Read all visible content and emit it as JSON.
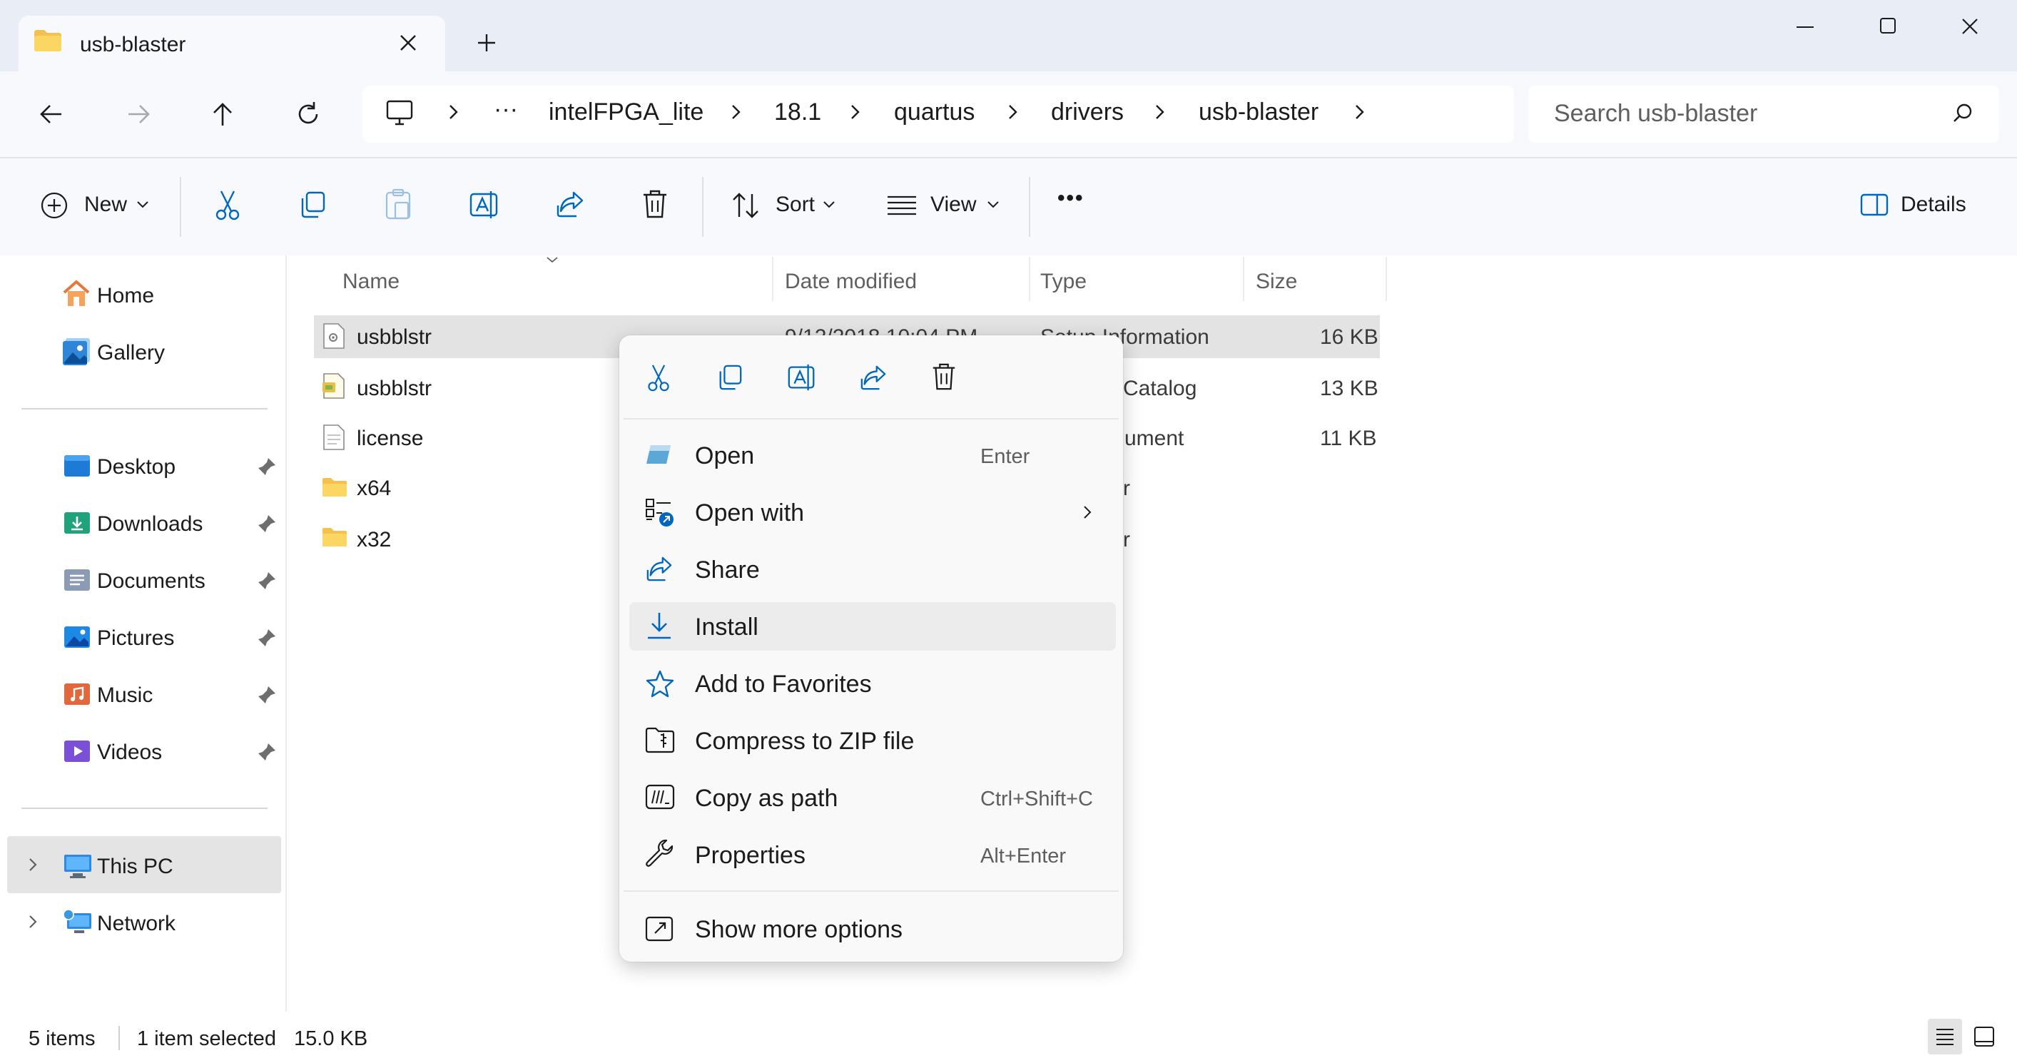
{
  "window": {
    "tab_title": "usb-blaster"
  },
  "breadcrumb": {
    "ellipsis": "···",
    "items": [
      "intelFPGA_lite",
      "18.1",
      "quartus",
      "drivers",
      "usb-blaster"
    ]
  },
  "search": {
    "placeholder": "Search usb-blaster"
  },
  "toolbar": {
    "new_label": "New",
    "sort_label": "Sort",
    "view_label": "View",
    "more_label": "•••",
    "details_label": "Details"
  },
  "sidebar": {
    "items": [
      {
        "label": "Home"
      },
      {
        "label": "Gallery"
      },
      {
        "label": "Desktop"
      },
      {
        "label": "Downloads"
      },
      {
        "label": "Documents"
      },
      {
        "label": "Pictures"
      },
      {
        "label": "Music"
      },
      {
        "label": "Videos"
      },
      {
        "label": "This PC"
      },
      {
        "label": "Network"
      }
    ]
  },
  "file_list": {
    "columns": [
      "Name",
      "Date modified",
      "Type",
      "Size"
    ],
    "rows": [
      {
        "name": "usbblstr",
        "date": "9/12/2018 10:04 PM",
        "type": "Setup Information",
        "size": "16 KB",
        "selected": true
      },
      {
        "name": "usbblstr",
        "date": "",
        "type": "Catalog",
        "size": "13 KB"
      },
      {
        "name": "license",
        "date": "",
        "type": "ument",
        "size": "11 KB"
      },
      {
        "name": "x64",
        "date": "",
        "type": "r",
        "size": ""
      },
      {
        "name": "x32",
        "date": "",
        "type": "r",
        "size": ""
      }
    ]
  },
  "context_menu": {
    "items": [
      {
        "label": "Open",
        "accel": "Enter"
      },
      {
        "label": "Open with",
        "accel": ""
      },
      {
        "label": "Share",
        "accel": ""
      },
      {
        "label": "Install",
        "accel": ""
      },
      {
        "label": "Add to Favorites",
        "accel": ""
      },
      {
        "label": "Compress to ZIP file",
        "accel": ""
      },
      {
        "label": "Copy as path",
        "accel": "Ctrl+Shift+C"
      },
      {
        "label": "Properties",
        "accel": "Alt+Enter"
      },
      {
        "label": "Show more options",
        "accel": ""
      }
    ]
  },
  "status": {
    "items_count": "5 items",
    "selection": "1 item selected",
    "size": "15.0 KB"
  },
  "colors": {
    "accent": "#0067c0",
    "selection": "#e3e3e3",
    "tabstrip": "#e9eef6"
  }
}
